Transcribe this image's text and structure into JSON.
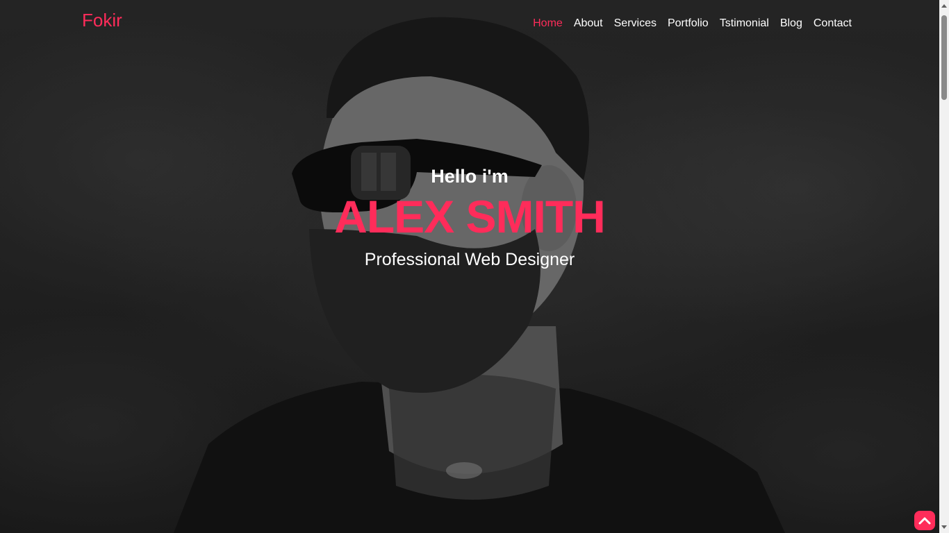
{
  "brand": {
    "name": "Fokir",
    "accent_color": "#ff2c5a"
  },
  "nav": {
    "items": [
      {
        "label": "Home",
        "active": true
      },
      {
        "label": "About",
        "active": false
      },
      {
        "label": "Services",
        "active": false
      },
      {
        "label": "Portfolio",
        "active": false
      },
      {
        "label": "Tstimonial",
        "active": false
      },
      {
        "label": "Blog",
        "active": false
      },
      {
        "label": "Contact",
        "active": false
      }
    ]
  },
  "hero": {
    "greeting": "Hello i'm",
    "name": "ALEX SMITH",
    "role": "Professional Web Designer",
    "background_image": "bearded-man-sunglasses-tattoo-portrait"
  },
  "back_to_top": {
    "icon": "chevron-up-icon"
  }
}
